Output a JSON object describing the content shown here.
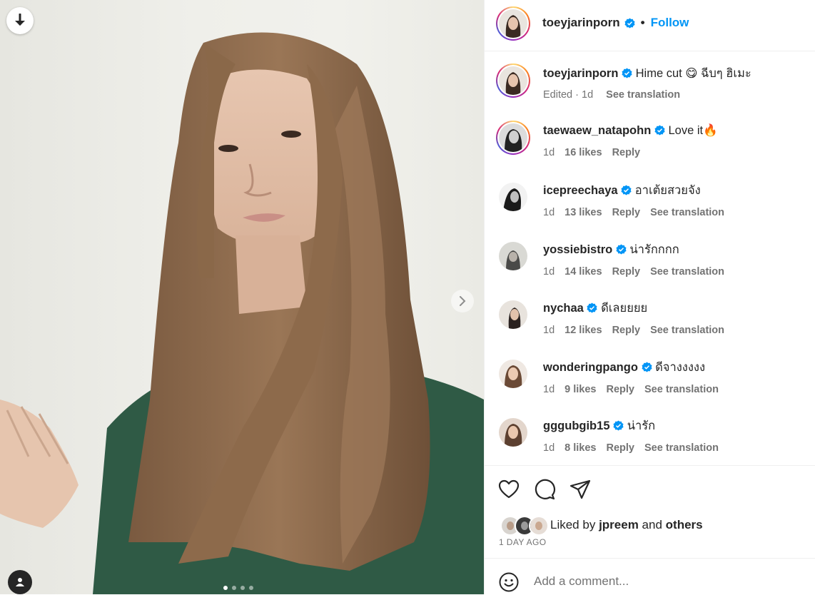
{
  "post": {
    "author": "toeyjarinporn",
    "follow_label": "Follow",
    "header_separator": "•",
    "icons": {
      "verified": "verified-badge-icon",
      "download": "download-arrow-icon",
      "next": "chevron-right-icon",
      "tag": "person-tag-icon"
    },
    "carousel": {
      "slides": 4,
      "active_index": 0
    },
    "colors": {
      "accent": "#0095f6",
      "verified": "#0095f6",
      "text": "#262626",
      "muted": "#737373"
    }
  },
  "caption": {
    "user": "toeyjarinporn",
    "text": "Hime cut 😋 ฉีบๆ ฮิเมะ",
    "edited": "Edited",
    "time": "1d",
    "translate": "See translation"
  },
  "comments": [
    {
      "user": "taewaew_natapohn",
      "text": "Love it🔥",
      "time": "1d",
      "likes": "16 likes",
      "reply": "Reply",
      "translate": ""
    },
    {
      "user": "icepreechaya",
      "text": "อาเต้ยสวยจัง",
      "time": "1d",
      "likes": "13 likes",
      "reply": "Reply",
      "translate": "See translation"
    },
    {
      "user": "yossiebistro",
      "text": "น่ารักกกก",
      "time": "1d",
      "likes": "14 likes",
      "reply": "Reply",
      "translate": "See translation"
    },
    {
      "user": "nychaa",
      "text": "ดีเลยยยย",
      "time": "1d",
      "likes": "12 likes",
      "reply": "Reply",
      "translate": "See translation"
    },
    {
      "user": "wonderingpango",
      "text": "ดีจางงงงง",
      "time": "1d",
      "likes": "9 likes",
      "reply": "Reply",
      "translate": "See translation"
    },
    {
      "user": "gggubgib15",
      "text": "น่ารัก",
      "time": "1d",
      "likes": "8 likes",
      "reply": "Reply",
      "translate": "See translation"
    }
  ],
  "actions": {
    "like_icon": "heart-icon",
    "comment_icon": "comment-bubble-icon",
    "share_icon": "paper-plane-icon"
  },
  "likes": {
    "prefix": "Liked by",
    "user": "jpreem",
    "and": "and",
    "others": "others"
  },
  "timestamp": "1 DAY AGO",
  "composer": {
    "placeholder": "Add a comment...",
    "emoji_icon": "smiley-icon"
  }
}
